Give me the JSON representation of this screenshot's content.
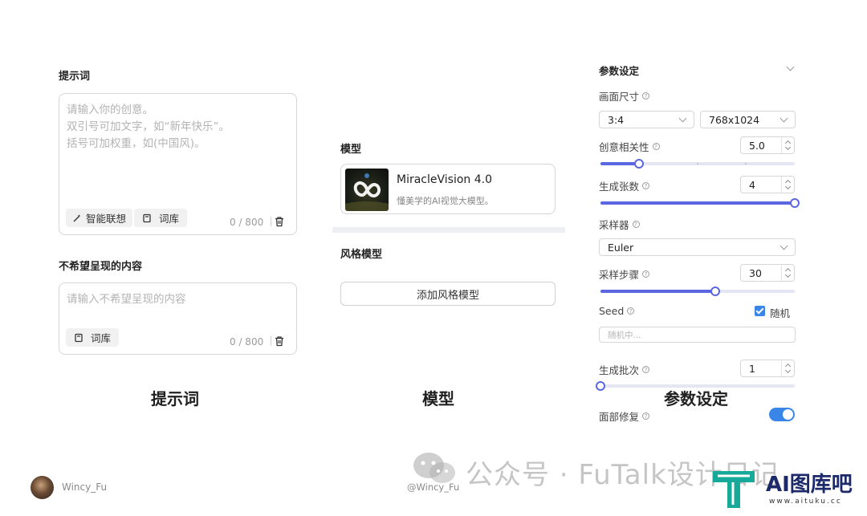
{
  "prompt": {
    "title": "提示词",
    "placeholder_lines": [
      "请输入你的创意。",
      "双引号可加文字，如“新年快乐”。",
      "括号可加权重，如(中国风)。"
    ],
    "smart_assoc_label": "智能联想",
    "lexicon_label": "词库",
    "counter": "0 / 800"
  },
  "negative": {
    "title": "不希望呈现的内容",
    "placeholder": "请输入不希望呈现的内容",
    "lexicon_label": "词库",
    "counter": "0 / 800"
  },
  "model": {
    "title": "模型",
    "name": "MiracleVision 4.0",
    "description": "懂美学的AI视觉大模型。"
  },
  "style_model": {
    "title": "风格模型",
    "add_button": "添加风格模型"
  },
  "params": {
    "title": "参数设定",
    "canvas_size_label": "画面尺寸",
    "ratio": "3:4",
    "resolution": "768x1024",
    "relevance_label": "创意相关性",
    "relevance_value": "5.0",
    "relevance_fraction": 0.2,
    "count_label": "生成张数",
    "count_value": "4",
    "count_fraction": 1.0,
    "sampler_label": "采样器",
    "sampler_value": "Euler",
    "steps_label": "采样步骤",
    "steps_value": "30",
    "steps_fraction": 0.59,
    "seed_label": "Seed",
    "random_label": "随机",
    "random_checked": true,
    "seed_placeholder": "随机中...",
    "batch_label": "生成批次",
    "batch_value": "1",
    "batch_fraction": 0.0,
    "face_fix_label": "面部修复",
    "face_fix_on": true
  },
  "captions": {
    "prompt": "提示词",
    "model": "模型",
    "params": "参数设定"
  },
  "footer": {
    "author": "Wincy_Fu",
    "handle": "@Wincy_Fu",
    "watermark": "公众号 · FuTalk设计日记",
    "logo_text": "AI图库吧",
    "logo_sub": "www.aituku.cc"
  },
  "colors": {
    "accent": "#5a67e0",
    "toggle_blue": "#3a86e8",
    "logo_teal": "#17a99a"
  }
}
